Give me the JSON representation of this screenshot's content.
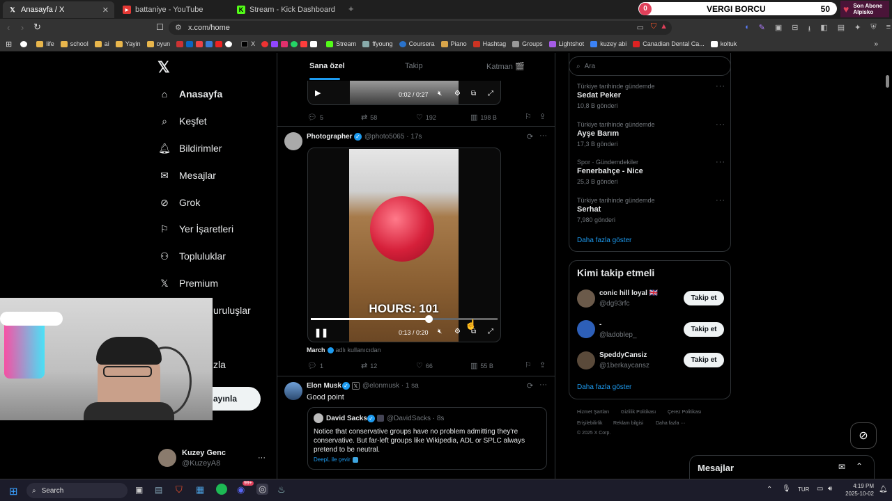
{
  "browser": {
    "tabs": [
      {
        "title": "Anasayfa / X",
        "icon": "x-logo-icon"
      },
      {
        "title": "battaniye - YouTube",
        "icon": "youtube-icon"
      },
      {
        "title": "Stream - Kick Dashboard",
        "icon": "kick-icon"
      }
    ],
    "url": "x.com/home",
    "bookmarks": [
      "life",
      "school",
      "ai",
      "Yayin",
      "oyun",
      "X",
      "Stream",
      "ffyoung",
      "Coursera",
      "Piano",
      "Hashtag",
      "Groups",
      "Lightshot",
      "kuzey abi",
      "Canadian Dental Ca...",
      "koltuk"
    ]
  },
  "overlay": {
    "sub_count": "0",
    "goal_label": "VERGI BORCU",
    "goal_value": "50",
    "last_sub_title": "Son Abone",
    "last_sub_name": "Alpisko"
  },
  "nav": {
    "items": [
      "Anasayfa",
      "Keşfet",
      "Bildirimler",
      "Mesajlar",
      "Grok",
      "Yer İşaretleri",
      "Topluluklar",
      "Premium"
    ],
    "partial_kuruluslar": "uruluşlar",
    "partial_fazla": "zla",
    "post_button": "ayınla",
    "profile_name": "Kuzey Genc",
    "profile_handle": "@KuzeyA8",
    "profile_more": "···"
  },
  "feed": {
    "tabs": [
      "Sana özel",
      "Takip",
      "Katman 🎬"
    ],
    "posts": [
      {
        "video_time": "0:02 / 0:27",
        "replies": "5",
        "reposts": "58",
        "likes": "192",
        "views": "198 B"
      },
      {
        "author": "Photographer",
        "handle": "@photo5065",
        "time": "17s",
        "video_caption": "HOURS: 101",
        "video_time": "0:13 / 0:20",
        "video_progress": 0.63,
        "community_note_author": "March",
        "community_note_suffix": "adlı kullanıcıdan",
        "replies": "1",
        "reposts": "12",
        "likes": "66",
        "views": "55 B"
      },
      {
        "author": "Elon Musk",
        "handle": "@elonmusk",
        "time": "1 sa",
        "text": "Good point",
        "quote": {
          "author": "David Sacks",
          "handle": "@DavidSacks",
          "time": "8s",
          "text": "Notice that conservative groups have no problem admitting they're conservative. But far-left groups like Wikipedia, ADL or SPLC always pretend to be neutral.",
          "translate": "DeepL ile çevir"
        }
      }
    ]
  },
  "sidebar": {
    "search_placeholder": "Ara",
    "trends": [
      {
        "category": "Türkiye tarihinde gündemde",
        "title": "Sedat Peker",
        "count": "10,8 B gönderi"
      },
      {
        "category": "Türkiye tarihinde gündemde",
        "title": "Ayşe Barım",
        "count": "17,3 B gönderi"
      },
      {
        "category": "Spor · Gündemdekiler",
        "title": "Fenerbahçe - Nice",
        "count": "25,3 B gönderi"
      },
      {
        "category": "Türkiye tarihinde gündemde",
        "title": "Serhat",
        "count": "7,980 gönderi"
      }
    ],
    "show_more": "Daha fazla göster",
    "who_to_follow_title": "Kimi takip etmeli",
    "who_to_follow": [
      {
        "name": "conic hill loyal 🇬🇧",
        "handle": "@dg93rfc",
        "button": "Takip et"
      },
      {
        "name": "-",
        "handle": "@ladoblep_",
        "button": "Takip et"
      },
      {
        "name": "SpeddyCansiz",
        "handle": "@1berkaycansz",
        "button": "Takip et"
      }
    ],
    "show_more_2": "Daha fazla göster",
    "footer": [
      "Hizmet Şartları",
      "Gizlilik Politikası",
      "Çerez Politikası",
      "Erişilebilirlik",
      "Reklam bilgisi",
      "Daha fazla ···",
      "© 2025 X Corp."
    ],
    "messages_label": "Mesajlar"
  },
  "taskbar": {
    "search": "Search",
    "lang": "TUR",
    "time": "4:19 PM",
    "date": "2025-10-02",
    "discord_badge": "99+"
  },
  "colors": {
    "accent": "#1d9bf0",
    "background": "#000000",
    "border": "#2f3336"
  }
}
